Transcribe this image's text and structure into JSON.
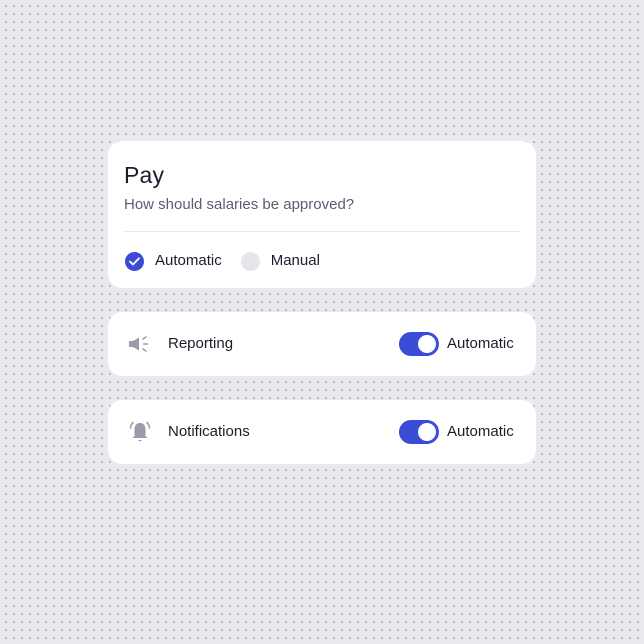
{
  "pay": {
    "title": "Pay",
    "subtitle": "How should salaries be approved?",
    "options": [
      {
        "label": "Automatic",
        "selected": true
      },
      {
        "label": "Manual",
        "selected": false
      }
    ]
  },
  "settings": [
    {
      "label": "Reporting",
      "icon": "megaphone-icon",
      "toggle_on": true,
      "toggle_label": "Automatic"
    },
    {
      "label": "Notifications",
      "icon": "bell-ringing-icon",
      "toggle_on": true,
      "toggle_label": "Automatic"
    }
  ],
  "colors": {
    "accent": "#3a4bd6",
    "background": "#eaeaee",
    "card": "#ffffff",
    "text": "#1b1d2c",
    "muted_text": "#5a5e6e",
    "icon": "#9a9cab"
  }
}
